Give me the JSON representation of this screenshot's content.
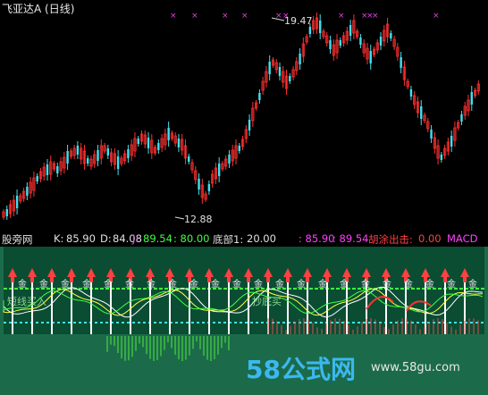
{
  "title": "飞亚达A (日线)",
  "price_high_label": "19.47",
  "price_low_label": "12.88",
  "indicator_bar": {
    "app_name": "股旁网",
    "k_label": "K:",
    "k_value": "85.90",
    "d_label": "D:",
    "d_value": "84.08",
    "j_label": "J:",
    "j_value": "89.54",
    "j_extra": ": 80.00",
    "bottom_label": "底部1:",
    "bottom_value": "20.00",
    "v1": ": 85.90",
    "v2": ": 89.54",
    "escape_label": "胡涂出击:",
    "escape_value": "0.00",
    "macd": "MACD"
  },
  "lower_panel": {
    "label_gold": "金",
    "label_buy": "短线买入",
    "label_buy2": "抄底买"
  },
  "watermark": {
    "logo": "58公式网",
    "url": "www.58gu.com"
  },
  "colors": {
    "up": "#ff3030",
    "down": "#40e0f0",
    "panel_green": "#1b6b4a",
    "arrow": "#ff4040"
  }
}
